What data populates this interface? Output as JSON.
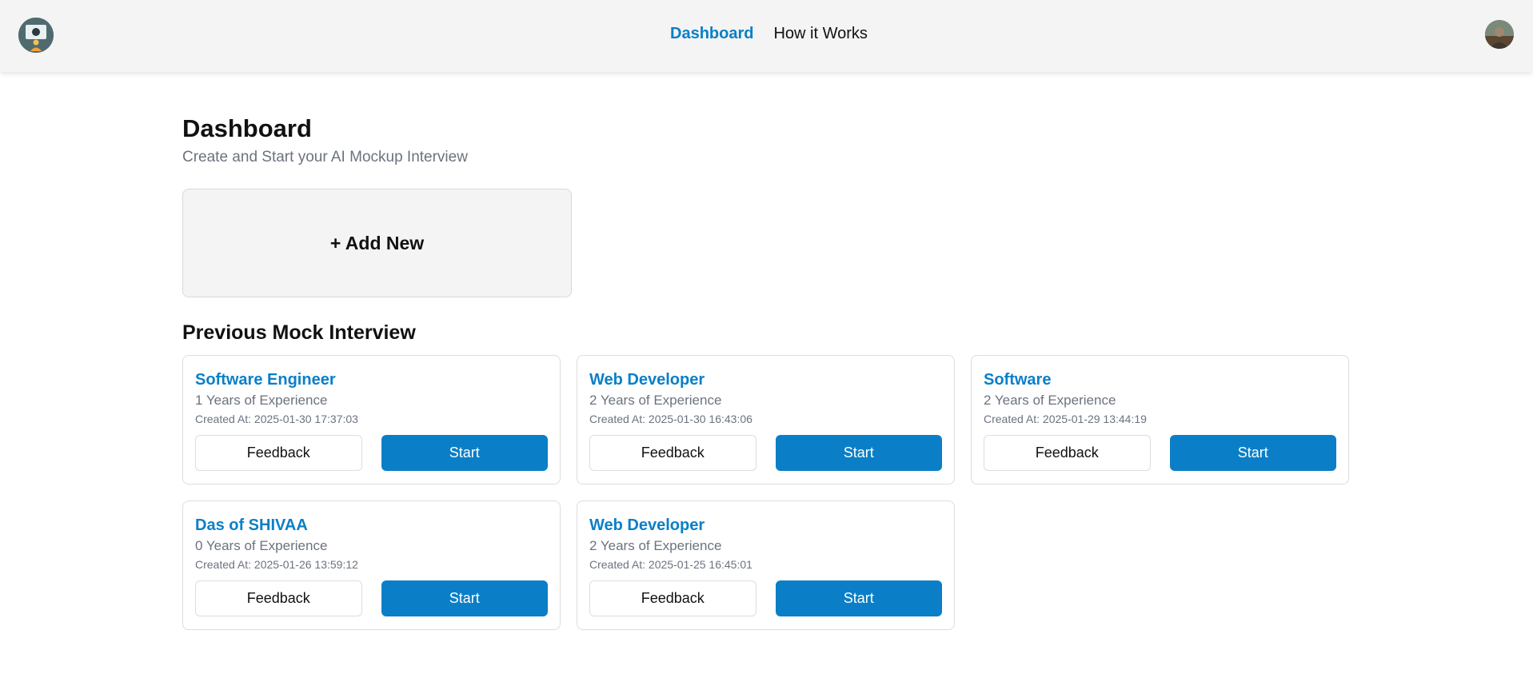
{
  "header": {
    "logo_icon": "interview-logo-icon",
    "nav": [
      {
        "label": "Dashboard",
        "active": true
      },
      {
        "label": "How it Works",
        "active": false
      }
    ],
    "avatar_icon": "user-avatar-icon"
  },
  "dashboard": {
    "title": "Dashboard",
    "subtitle": "Create and Start your AI Mockup Interview",
    "add_new_label": "+ Add New",
    "section_title": "Previous Mock Interview"
  },
  "interviews": [
    {
      "title": "Software Engineer",
      "experience": "1 Years of Experience",
      "created": "Created At: 2025-01-30 17:37:03",
      "feedback_label": "Feedback",
      "start_label": "Start"
    },
    {
      "title": "Web Developer",
      "experience": "2 Years of Experience",
      "created": "Created At: 2025-01-30 16:43:06",
      "feedback_label": "Feedback",
      "start_label": "Start"
    },
    {
      "title": "Software",
      "experience": "2 Years of Experience",
      "created": "Created At: 2025-01-29 13:44:19",
      "feedback_label": "Feedback",
      "start_label": "Start"
    },
    {
      "title": "Das of SHIVAA",
      "experience": "0 Years of Experience",
      "created": "Created At: 2025-01-26 13:59:12",
      "feedback_label": "Feedback",
      "start_label": "Start"
    },
    {
      "title": "Web Developer",
      "experience": "2 Years of Experience",
      "created": "Created At: 2025-01-25 16:45:01",
      "feedback_label": "Feedback",
      "start_label": "Start"
    }
  ],
  "colors": {
    "accent": "#0a7fc7",
    "header_bg": "#f4f4f4",
    "muted_text": "#6b7280"
  }
}
